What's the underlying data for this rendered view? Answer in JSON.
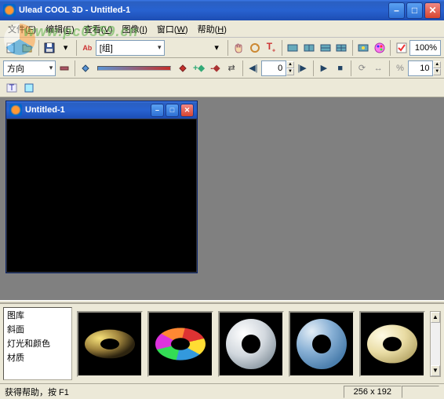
{
  "app": {
    "title": "Ulead COOL 3D - Untitled-1"
  },
  "menu": {
    "file": {
      "label": "文件",
      "key": "F"
    },
    "edit": {
      "label": "编辑",
      "key": "E"
    },
    "view": {
      "label": "查看",
      "key": "V"
    },
    "image": {
      "label": "图像",
      "key": "I"
    },
    "window": {
      "label": "窗口",
      "key": "W"
    },
    "help": {
      "label": "帮助",
      "key": "H"
    }
  },
  "watermark": "www.pc0359.cn",
  "toolbar1": {
    "object_dropdown": "[组]",
    "zoom": "100%"
  },
  "toolbar2": {
    "mode_dropdown": "方向",
    "frame": "0",
    "value": "10"
  },
  "child_window": {
    "title": "Untitled-1"
  },
  "categories": [
    "图库",
    "斜面",
    "灯光和颜色",
    "材质"
  ],
  "statusbar": {
    "help": "获得帮助，按 F1",
    "dims": "256 x 192"
  }
}
